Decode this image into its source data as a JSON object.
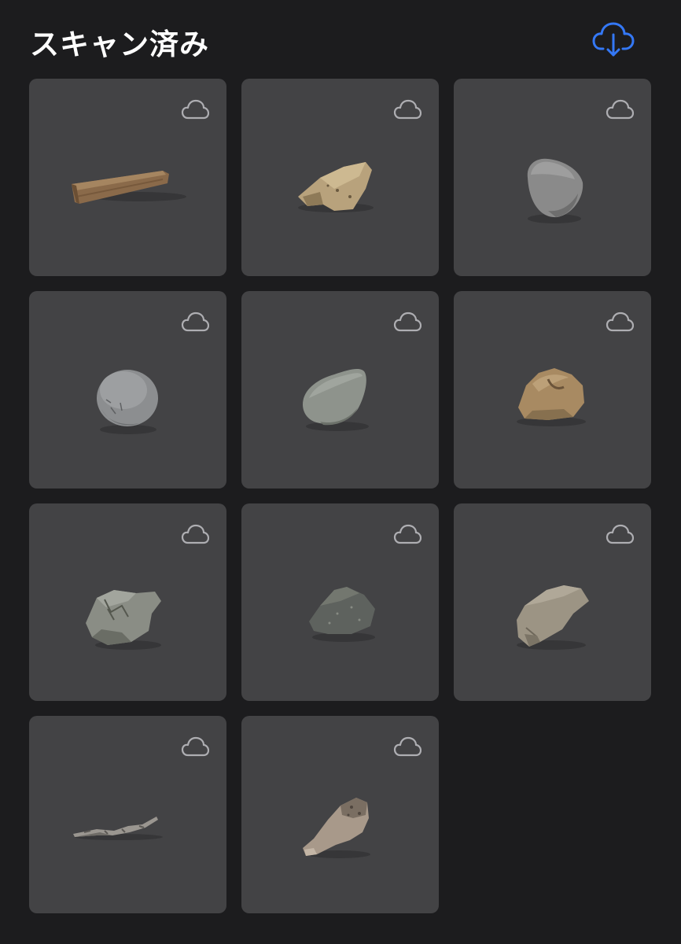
{
  "header": {
    "title": "スキャン済み",
    "download_icon": "cloud-download-icon",
    "accent_color": "#3478f6"
  },
  "grid": {
    "cloud_icon": "cloud-icon",
    "items": [
      {
        "object": "wooden-stick"
      },
      {
        "object": "tan-rock"
      },
      {
        "object": "gray-rounded-stone"
      },
      {
        "object": "gray-oval-pebble"
      },
      {
        "object": "gray-green-pebble"
      },
      {
        "object": "brown-rock"
      },
      {
        "object": "gray-jagged-rock"
      },
      {
        "object": "dark-gray-rock"
      },
      {
        "object": "beige-rock"
      },
      {
        "object": "twig"
      },
      {
        "object": "bone-fragment"
      }
    ]
  }
}
